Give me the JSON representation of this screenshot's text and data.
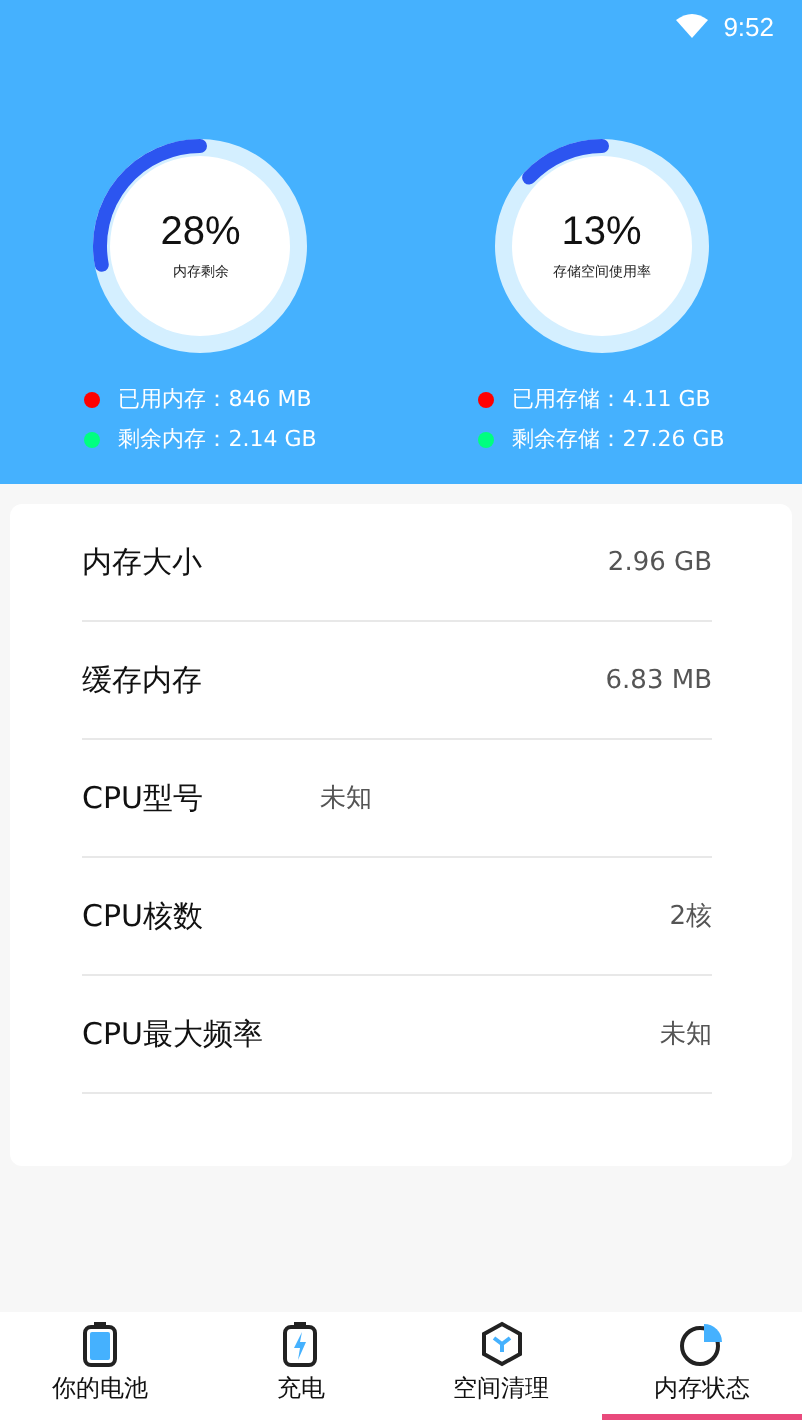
{
  "status_bar": {
    "time": "9:52"
  },
  "gauges": [
    {
      "value": "28%",
      "caption": "内存剩余",
      "legend": [
        {
          "label": "已用内存：846 MB",
          "color": "#ff0000"
        },
        {
          "label": "剩余内存：2.14 GB",
          "color": "#00ff7f"
        }
      ]
    },
    {
      "value": "13%",
      "caption": "存储空间使用率",
      "legend": [
        {
          "label": "已用存储：4.11 GB",
          "color": "#ff0000"
        },
        {
          "label": "剩余存储：27.26 GB",
          "color": "#00ff7f"
        }
      ]
    }
  ],
  "rows": [
    {
      "label": "内存大小",
      "value": "2.96 GB",
      "kind": "right"
    },
    {
      "label": "缓存内存",
      "value": "6.83 MB",
      "kind": "right"
    },
    {
      "label": "CPU型号",
      "value": "未知",
      "kind": "inline"
    },
    {
      "label": "CPU核数",
      "value": "2核",
      "kind": "right"
    },
    {
      "label": "CPU最大频率",
      "value": "未知",
      "kind": "right"
    }
  ],
  "tabs": [
    {
      "label": "你的电池",
      "kind": "battery",
      "selected": false
    },
    {
      "label": "充电",
      "kind": "charge",
      "selected": false
    },
    {
      "label": "空间清理",
      "kind": "clean",
      "selected": false
    },
    {
      "label": "内存状态",
      "kind": "pie",
      "selected": true
    }
  ]
}
